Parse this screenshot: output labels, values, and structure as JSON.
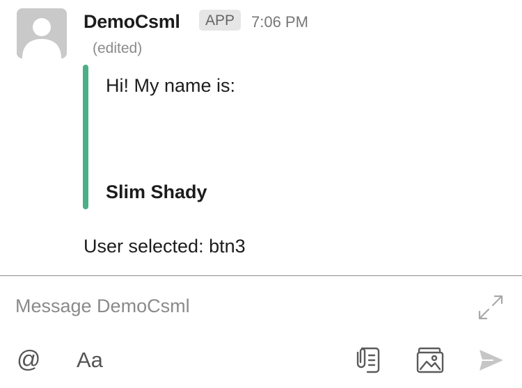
{
  "message": {
    "sender": "DemoCsml",
    "badge": "APP",
    "time": "7:06 PM",
    "edited": "(edited)",
    "attachment": {
      "text": "Hi! My name is:",
      "name": "Slim Shady",
      "accent_color": "#4caf88"
    },
    "selection_text": "User selected: btn3"
  },
  "composer": {
    "placeholder": "Message DemoCsml",
    "mention_label": "@",
    "format_label": "Aa",
    "icons": {
      "expand": "expand-icon",
      "file": "file-attachment-icon",
      "image": "image-upload-icon",
      "send": "send-icon"
    }
  }
}
